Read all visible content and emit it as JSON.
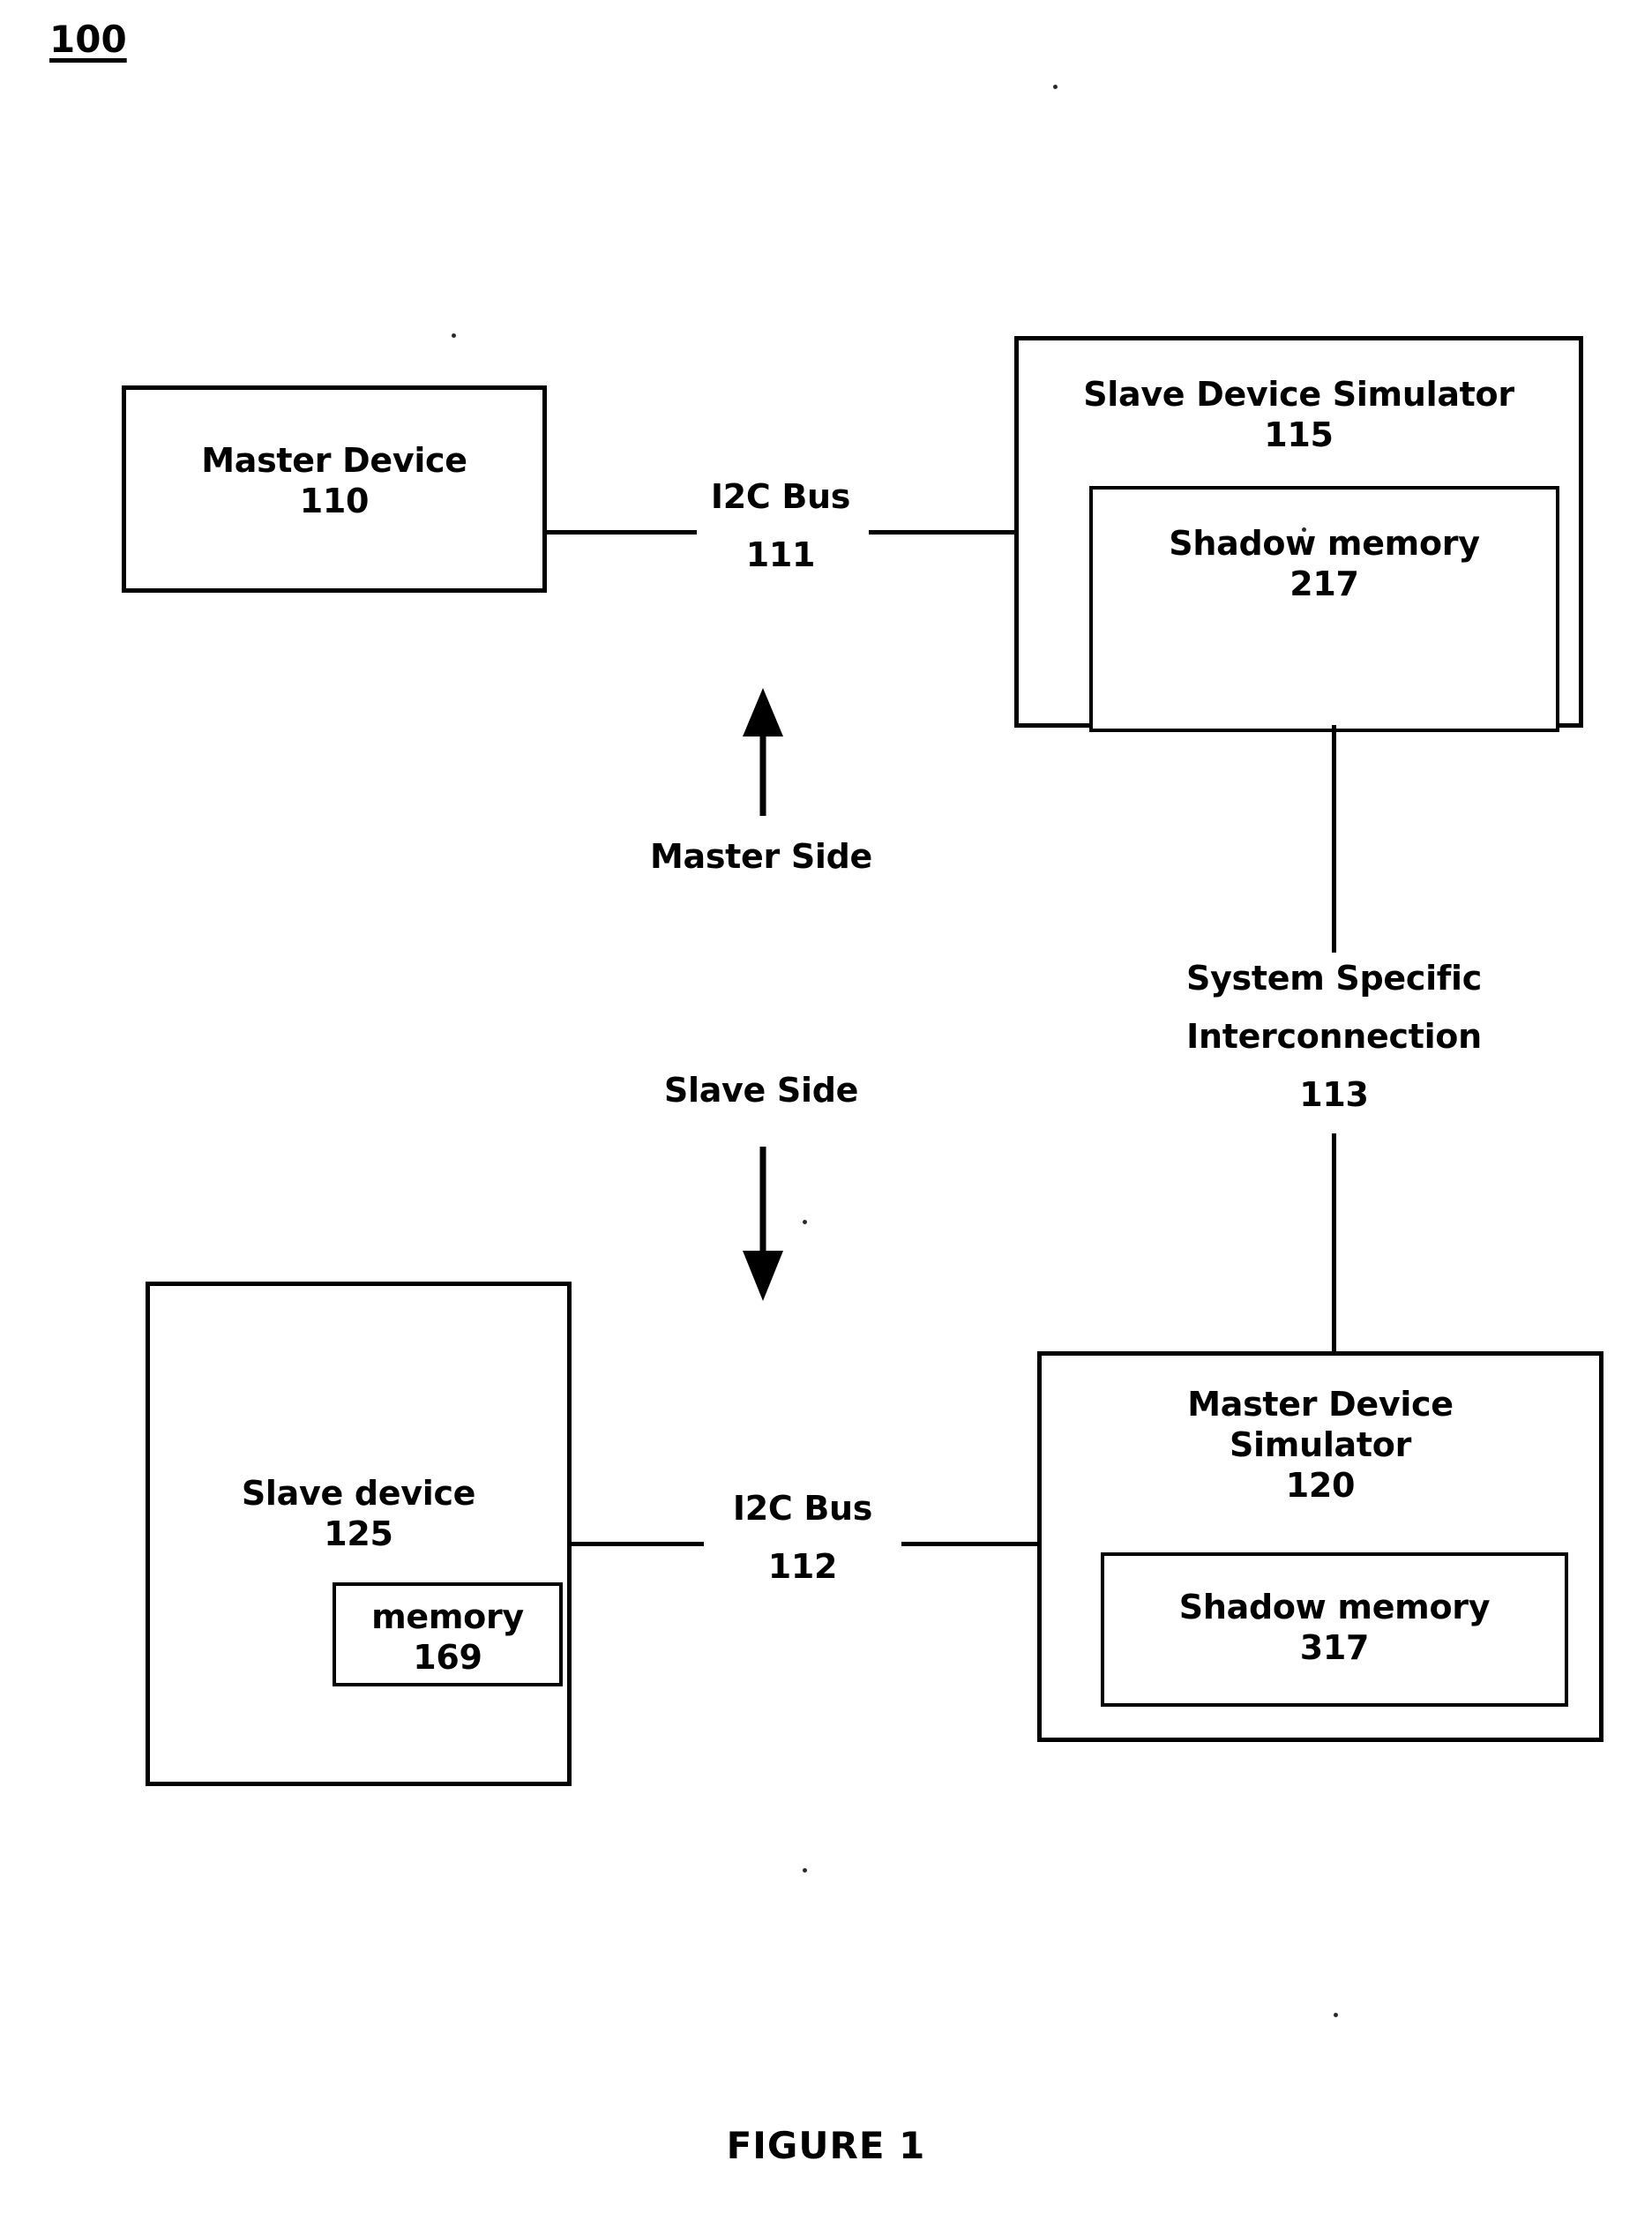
{
  "figure": {
    "reference_numeral": "100",
    "caption": "FIGURE 1"
  },
  "blocks": {
    "master_device": {
      "title": "Master Device",
      "numeral": "110"
    },
    "slave_device_simulator": {
      "title": "Slave Device Simulator",
      "numeral": "115",
      "inner": {
        "title": "Shadow memory",
        "numeral": "217"
      }
    },
    "slave_device": {
      "title": "Slave device",
      "numeral": "125",
      "inner": {
        "title": "memory",
        "numeral": "169"
      }
    },
    "master_device_simulator": {
      "title": "Master Device",
      "title_line2": "Simulator",
      "numeral": "120",
      "inner": {
        "title": "Shadow memory",
        "numeral": "317"
      }
    }
  },
  "connectors": {
    "i2c_bus_top": {
      "label": "I2C Bus",
      "numeral": "111"
    },
    "i2c_bus_bottom": {
      "label": "I2C Bus",
      "numeral": "112"
    },
    "system_interconnection": {
      "line1": "System Specific",
      "line2": "Interconnection",
      "numeral": "113"
    }
  },
  "annotations": {
    "master_side": "Master Side",
    "slave_side": "Slave Side"
  }
}
